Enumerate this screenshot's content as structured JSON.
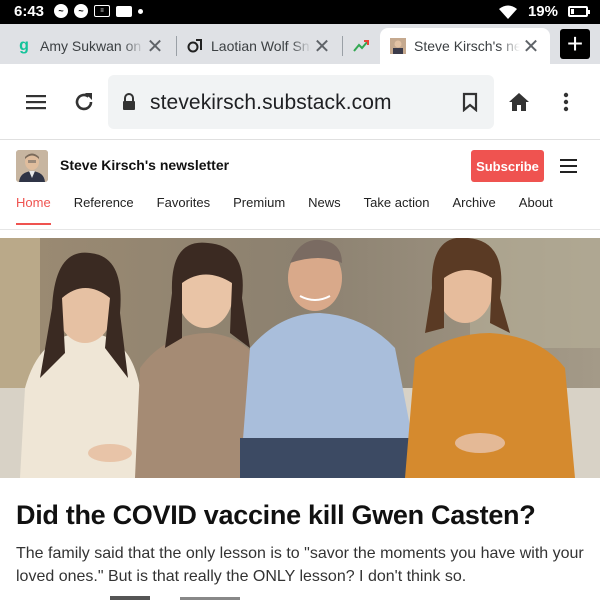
{
  "status": {
    "time": "6:43",
    "notification_icons": [
      "messenger-icon",
      "messenger-icon",
      "news-icon",
      "mail-icon",
      "dot-icon"
    ],
    "battery": "19%",
    "battery_level": 0.19
  },
  "tabs": [
    {
      "title": "Amy Sukwan on",
      "favicon": "grammarly-g",
      "active": false
    },
    {
      "title": "Laotian Wolf Sna",
      "favicon": "link-swirl",
      "active": false
    },
    {
      "title": "",
      "favicon": "chart-arrow",
      "active": false
    },
    {
      "title": "Steve Kirsch's ne",
      "favicon": "avatar",
      "active": true
    }
  ],
  "toolbar": {
    "url": "stevekirsch.substack.com"
  },
  "publication": {
    "name": "Steve Kirsch's newsletter",
    "subscribe_label": "Subscribe",
    "nav": [
      "Home",
      "Reference",
      "Favorites",
      "Premium",
      "News",
      "Take action",
      "Archive",
      "About"
    ],
    "active_nav": "Home"
  },
  "article": {
    "title": "Did the COVID vaccine kill Gwen Casten?",
    "subtitle": "The family said that the only lesson is to \"savor the moments you have with your loved ones.\" But is that really the ONLY lesson? I don't think so."
  },
  "colors": {
    "accent": "#ef5350",
    "tab_strip": "#dfe1e5",
    "omnibox": "#f1f3f4"
  }
}
